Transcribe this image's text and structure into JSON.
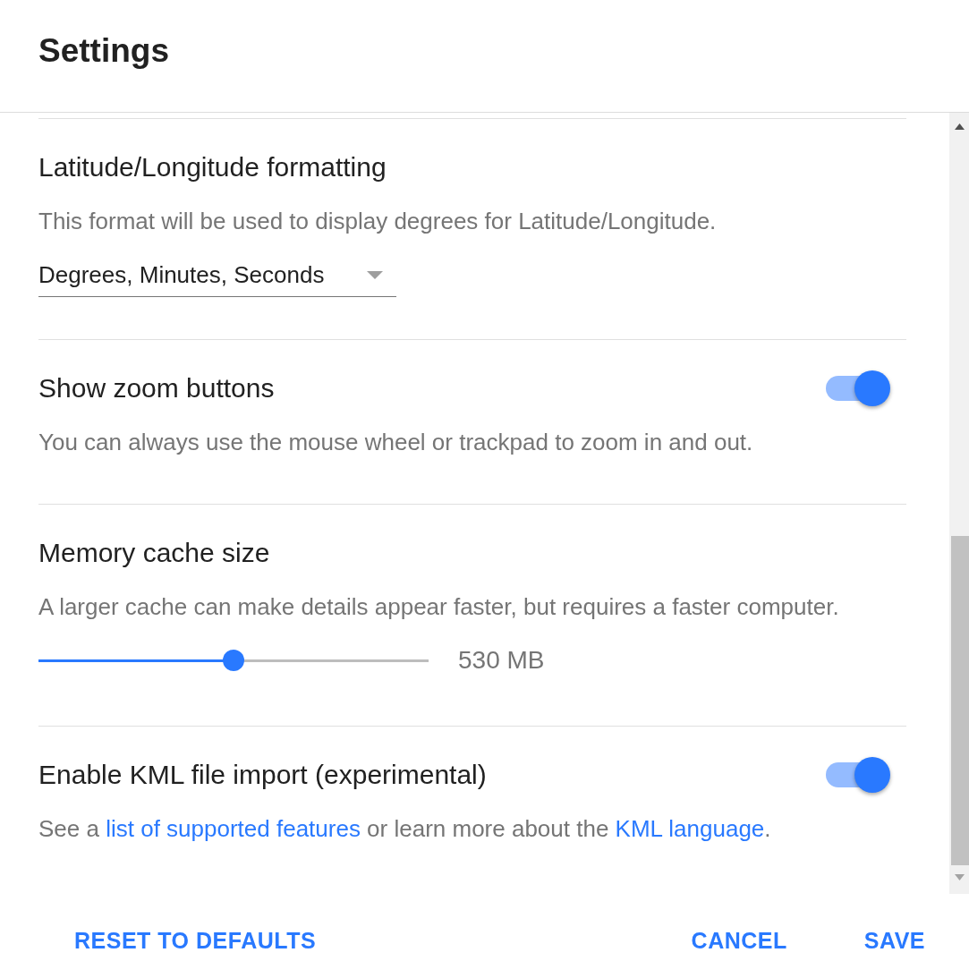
{
  "dialog": {
    "title": "Settings"
  },
  "sections": [
    {
      "kind": "dropdown",
      "title": "Latitude/Longitude formatting",
      "description": [
        {
          "kind": "text",
          "text": "This format will be used to display degrees for Latitude/Longitude."
        }
      ],
      "dropdown": {
        "value": "Degrees, Minutes, Seconds"
      }
    },
    {
      "kind": "toggle",
      "title": "Show zoom buttons",
      "on": true,
      "description": [
        {
          "kind": "text",
          "text": "You can always use the mouse wheel or trackpad to zoom in and out."
        }
      ]
    },
    {
      "kind": "slider",
      "title": "Memory cache size",
      "description": [
        {
          "kind": "text",
          "text": "A larger cache can make details appear faster, but requires a faster computer."
        }
      ],
      "slider": {
        "level": 0.5,
        "reading": "530 MB"
      }
    },
    {
      "kind": "toggle",
      "title": "Enable KML file import (experimental)",
      "on": true,
      "description": [
        {
          "kind": "text",
          "text": "See a "
        },
        {
          "kind": "link",
          "text": "list of supported features"
        },
        {
          "kind": "text",
          "text": " or learn more about the "
        },
        {
          "kind": "link",
          "text": "KML language"
        },
        {
          "kind": "text",
          "text": "."
        }
      ]
    }
  ],
  "footer": {
    "start_buttons": [
      {
        "label": "RESET TO DEFAULTS"
      }
    ],
    "end_buttons": [
      {
        "label": "CANCEL"
      },
      {
        "label": "SAVE"
      }
    ]
  }
}
